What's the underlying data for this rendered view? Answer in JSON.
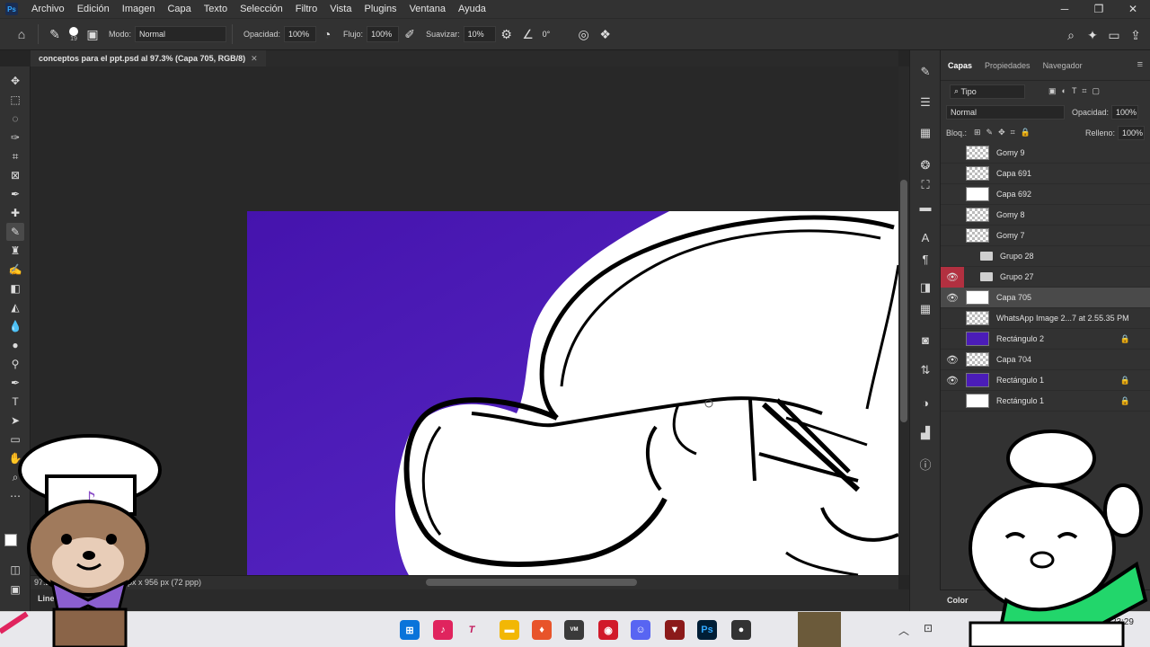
{
  "app": {
    "logo": "Ps"
  },
  "menubar": {
    "items": [
      "Archivo",
      "Edición",
      "Imagen",
      "Capa",
      "Texto",
      "Selección",
      "Filtro",
      "Vista",
      "Plugins",
      "Ventana",
      "Ayuda"
    ]
  },
  "options": {
    "brush_size": "19",
    "mode_label": "Modo:",
    "mode_value": "Normal",
    "opacity_label": "Opacidad:",
    "opacity_value": "100%",
    "flow_label": "Flujo:",
    "flow_value": "100%",
    "smooth_label": "Suavizar:",
    "smooth_value": "10%",
    "angle_value": "0°"
  },
  "document": {
    "tab_title": "conceptos para el ppt.psd al 97.3% (Capa 705, RGB/8)",
    "zoom_partial": "97.2",
    "doc_info": "px x 956 px (72 ppp)",
    "bottom_label": "Line"
  },
  "layers_panel": {
    "tabs": [
      "Capas",
      "Propiedades",
      "Navegador"
    ],
    "filter_value": "Tipo",
    "blend_mode": "Normal",
    "opacity_label": "Opacidad:",
    "opacity_value": "100%",
    "lock_label": "Bloq.:",
    "fill_label": "Relleno:",
    "fill_value": "100%",
    "layers": [
      {
        "name": "Gomy 9",
        "visible": false,
        "kind": "layer",
        "thumb": "checker"
      },
      {
        "name": "Capa 691",
        "visible": false,
        "kind": "layer",
        "thumb": "checker"
      },
      {
        "name": "Capa 692",
        "visible": false,
        "kind": "layer",
        "thumb": "white"
      },
      {
        "name": "Gomy 8",
        "visible": false,
        "kind": "layer",
        "thumb": "checker"
      },
      {
        "name": "Gomy 7",
        "visible": false,
        "kind": "layer",
        "thumb": "checker"
      },
      {
        "name": "Grupo 28",
        "visible": false,
        "kind": "group"
      },
      {
        "name": "Grupo 27",
        "visible": true,
        "kind": "group",
        "eye_highlight": true
      },
      {
        "name": "Capa 705",
        "visible": true,
        "kind": "layer",
        "thumb": "white",
        "selected": true
      },
      {
        "name": "WhatsApp Image 2...7 at 2.55.35 PM",
        "visible": false,
        "kind": "layer",
        "thumb": "checker"
      },
      {
        "name": "Rectángulo 2",
        "visible": false,
        "kind": "layer",
        "thumb": "purple",
        "locked": true
      },
      {
        "name": "Capa 704",
        "visible": true,
        "kind": "layer",
        "thumb": "checker"
      },
      {
        "name": "Rectángulo 1",
        "visible": true,
        "kind": "layer",
        "thumb": "purple",
        "locked": true
      },
      {
        "name": "Rectángulo 1",
        "visible": false,
        "kind": "layer",
        "thumb": "white",
        "locked": true
      }
    ]
  },
  "color_panel": {
    "title": "Color"
  },
  "taskbar": {
    "time": "23:29"
  },
  "colors": {
    "canvas_purple": "#4513ad",
    "ui_dark": "#323232",
    "eye_highlight": "#b23040"
  }
}
